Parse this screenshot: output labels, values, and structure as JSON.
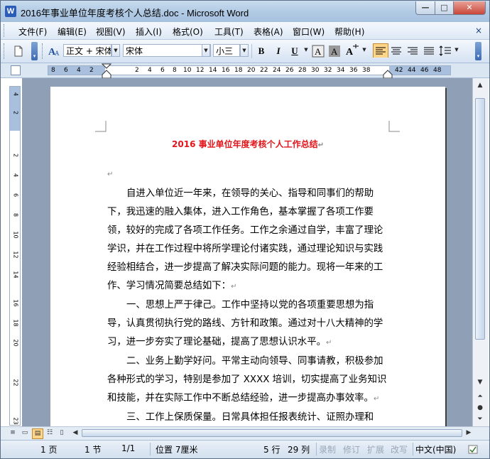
{
  "window": {
    "title": "2016年事业单位年度考核个人总结.doc - Microsoft Word",
    "app_icon": "W"
  },
  "window_controls": {
    "minimize": "—",
    "maximize": "□",
    "close": "✕"
  },
  "menu": {
    "items": [
      "文件(F)",
      "编辑(E)",
      "视图(V)",
      "插入(I)",
      "格式(O)",
      "工具(T)",
      "表格(A)",
      "窗口(W)",
      "帮助(H)"
    ],
    "close_doc": "×"
  },
  "toolbar": {
    "style_value": "正文 + 宋体",
    "font_value": "宋体",
    "size_value": "小三",
    "bold": "B",
    "italic": "I",
    "underline": "U"
  },
  "ruler": {
    "horizontal_ticks": [
      "8",
      "6",
      "4",
      "2",
      "2",
      "4",
      "6",
      "8",
      "10",
      "12",
      "14",
      "16",
      "18",
      "20",
      "22",
      "24",
      "26",
      "28",
      "30",
      "32",
      "34",
      "36",
      "38",
      "42",
      "44",
      "46",
      "48"
    ],
    "vertical_ticks": [
      "4",
      "2",
      "2",
      "4",
      "6",
      "8",
      "10",
      "12",
      "14",
      "16",
      "18",
      "20",
      "22",
      "23"
    ]
  },
  "document": {
    "title": "2016 事业单位年度考核个人工作总结",
    "paragraphs": [
      "自进入单位近一年来，在领导的关心、指导和同事们的帮助下，我迅速的融入集体，进入工作角色，基本掌握了各项工作要领，较好的完成了各项工作任务。工作之余通过自学，丰富了理论学识，并在工作过程中将所学理论付诸实践，通过理论知识与实践经验相结合，进一步提高了解决实际问题的能力。现将一年来的工作、学习情况简要总结如下：",
      "一、思想上严于律己。工作中坚持以党的各项重要思想为指导，认真贯彻执行党的路线、方针和政策。通过对十八大精神的学习，进一步夯实了理论基础，提高了思想认识水平。",
      "二、业务上勤学好问。平常主动向领导、同事请教，积极参加各种形式的学习，特别是参加了 XXXX 培训，切实提高了业务知识和技能，并在实际工作中不断总结经验，进一步提高办事效率。",
      "三、工作上保质保量。日常具体担任报表统计、证照办理和"
    ]
  },
  "status": {
    "page": "1 页",
    "section": "1 节",
    "page_of": "1/1",
    "position": "位置 7厘米",
    "line": "5 行",
    "column": "29 列",
    "rec": "录制",
    "trk": "修订",
    "ext": "扩展",
    "ovr": "改写",
    "language": "中文(中国)"
  },
  "colors": {
    "title_red": "#e2151b",
    "chrome_blue": "#b2cbe4",
    "doc_background": "#8f9fb5"
  }
}
